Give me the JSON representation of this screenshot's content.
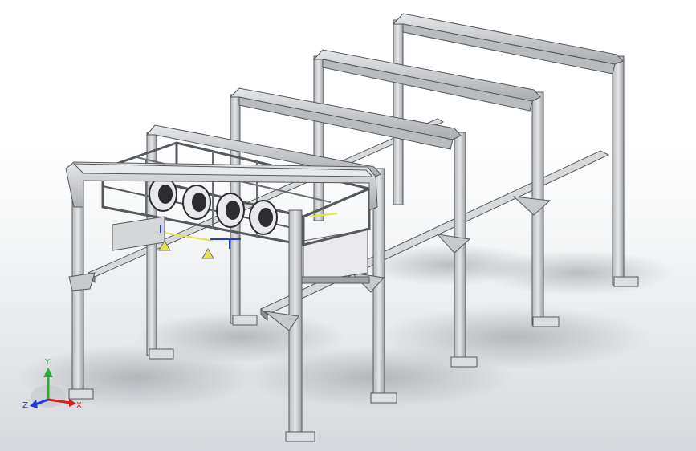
{
  "viewport": {
    "background_top": "#ffffff",
    "background_bottom": "#d6d9dd"
  },
  "model": {
    "frame_color": "#c9cbce",
    "frame_dark": "#6b6e72",
    "panel_color": "#e8e8ea",
    "fan_color": "#2b2d31"
  },
  "triad": {
    "x_label": "X",
    "y_label": "Y",
    "z_label": "Z",
    "x_color": "#d81e1e",
    "y_color": "#2fa83a",
    "z_color": "#2439d6"
  }
}
